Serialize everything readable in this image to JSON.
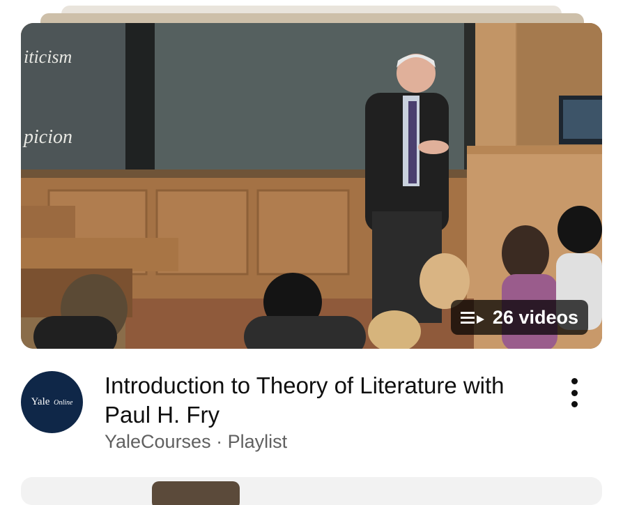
{
  "playlist": {
    "video_count_label": "26 videos",
    "title": "Introduction to Theory of Literature with Paul H. Fry",
    "channel": "YaleCourses",
    "separator": "·",
    "type": "Playlist",
    "thumbnail_chalk_text": [
      "iticism",
      "picion"
    ]
  },
  "channel_avatar": {
    "name": "Yale",
    "suffix": "Online",
    "bg_color": "#0f2748"
  },
  "icons": {
    "playlist": "playlist-play-icon",
    "more": "more-vert-icon"
  },
  "colors": {
    "title": "#0f0f0f",
    "meta": "#606060",
    "badge_bg": "#000000"
  }
}
